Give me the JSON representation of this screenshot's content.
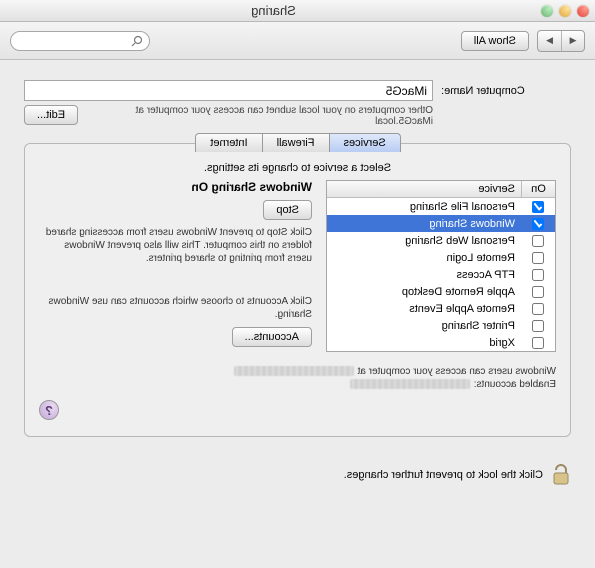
{
  "window": {
    "title": "Sharing"
  },
  "toolbar": {
    "show_all": "Show All"
  },
  "computer_name": {
    "label": "Computer Name:",
    "value": "iMacG5",
    "helper": "Other computers on your local subnet can access your computer at iMacG5.local",
    "edit_btn": "Edit..."
  },
  "tabs": {
    "services": "Services",
    "firewall": "Firewall",
    "internet": "Internet"
  },
  "hint": "Select a service to change its settings.",
  "svc_head": {
    "on": "On",
    "service": "Service"
  },
  "services": [
    {
      "on": true,
      "name": "Personal File Sharing",
      "selected": false
    },
    {
      "on": true,
      "name": "Windows Sharing",
      "selected": true
    },
    {
      "on": false,
      "name": "Personal Web Sharing",
      "selected": false
    },
    {
      "on": false,
      "name": "Remote Login",
      "selected": false
    },
    {
      "on": false,
      "name": "FTP Access",
      "selected": false
    },
    {
      "on": false,
      "name": "Apple Remote Desktop",
      "selected": false
    },
    {
      "on": false,
      "name": "Remote Apple Events",
      "selected": false
    },
    {
      "on": false,
      "name": "Printer Sharing",
      "selected": false
    },
    {
      "on": false,
      "name": "Xgrid",
      "selected": false
    }
  ],
  "detail": {
    "title": "Windows Sharing On",
    "stop_btn": "Stop",
    "desc": "Click Stop to prevent Windows users from accessing shared folders on this computer. This will also prevent Windows users from printing to shared printers.",
    "acct_desc": "Click Accounts to choose which accounts can use Windows Sharing.",
    "acct_btn": "Accounts..."
  },
  "footer": {
    "line1": "Windows users can access your computer at",
    "line2": "Enabled accounts:"
  },
  "lock": {
    "text": "Click the lock to prevent further changes."
  }
}
